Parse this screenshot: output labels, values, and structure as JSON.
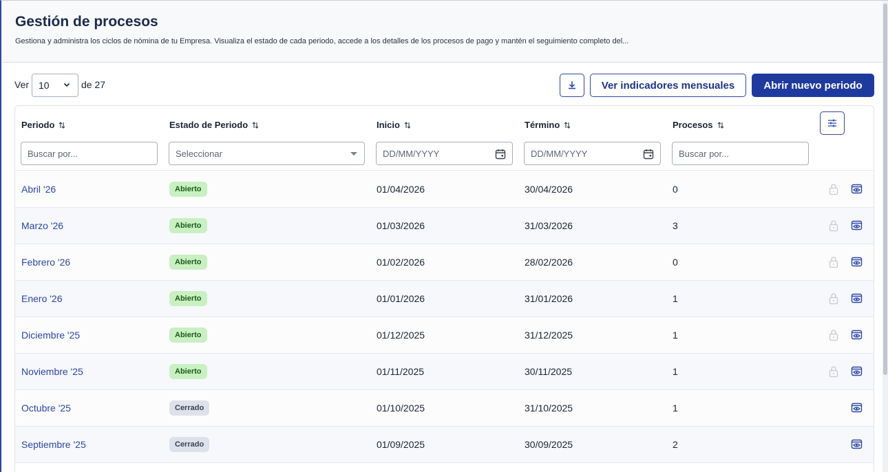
{
  "header": {
    "title": "Gestión de procesos",
    "subtitle": "Gestiona y administra los ciclos de nómina de tu Empresa. Visualiza el estado de cada periodo, accede a los detalles de los procesos de pago y mantén el seguimiento completo del..."
  },
  "toolbar": {
    "ver_label": "Ver",
    "page_size": "10",
    "of_label": "de 27",
    "download_icon": "download-icon",
    "indicators_label": "Ver indicadores mensuales",
    "new_period_label": "Abrir nuevo periodo"
  },
  "colors": {
    "brand": "#1f3a9e",
    "open_badge_bg": "#c9f0c2",
    "closed_badge_bg": "#dde1ea"
  },
  "table": {
    "columns": [
      {
        "label": "Periodo"
      },
      {
        "label": "Estado de Periodo"
      },
      {
        "label": "Inicio"
      },
      {
        "label": "Término"
      },
      {
        "label": "Procesos"
      }
    ],
    "filters": {
      "period_placeholder": "Buscar por...",
      "status_placeholder": "Seleccionar",
      "start_placeholder": "DD/MM/YYYY",
      "end_placeholder": "DD/MM/YYYY",
      "processes_placeholder": "Buscar por..."
    },
    "rows": [
      {
        "period": "Abril '26",
        "status": "Abierto",
        "start": "01/04/2026",
        "end": "30/04/2026",
        "processes": "0",
        "locked": true
      },
      {
        "period": "Marzo '26",
        "status": "Abierto",
        "start": "01/03/2026",
        "end": "31/03/2026",
        "processes": "3",
        "locked": true
      },
      {
        "period": "Febrero '26",
        "status": "Abierto",
        "start": "01/02/2026",
        "end": "28/02/2026",
        "processes": "0",
        "locked": true
      },
      {
        "period": "Enero '26",
        "status": "Abierto",
        "start": "01/01/2026",
        "end": "31/01/2026",
        "processes": "1",
        "locked": true
      },
      {
        "period": "Diciembre '25",
        "status": "Abierto",
        "start": "01/12/2025",
        "end": "31/12/2025",
        "processes": "1",
        "locked": true
      },
      {
        "period": "Noviembre '25",
        "status": "Abierto",
        "start": "01/11/2025",
        "end": "30/11/2025",
        "processes": "1",
        "locked": true
      },
      {
        "period": "Octubre '25",
        "status": "Cerrado",
        "start": "01/10/2025",
        "end": "31/10/2025",
        "processes": "1",
        "locked": false
      },
      {
        "period": "Septiembre '25",
        "status": "Cerrado",
        "start": "01/09/2025",
        "end": "30/09/2025",
        "processes": "2",
        "locked": false
      }
    ]
  }
}
